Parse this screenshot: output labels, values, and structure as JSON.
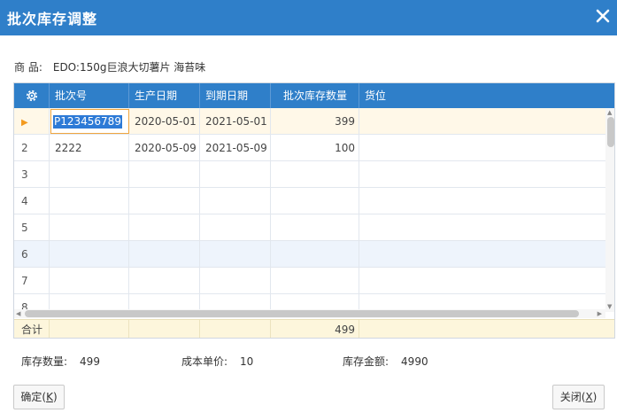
{
  "window": {
    "title": "批次库存调整"
  },
  "product": {
    "label": "商 品:",
    "value": "EDO:150g巨浪大切薯片 海苔味"
  },
  "grid": {
    "columns": [
      "批次号",
      "生产日期",
      "到期日期",
      "批次库存数量",
      "货位"
    ],
    "rows": [
      {
        "num": "",
        "batch": "P123456789",
        "prod": "2020-05-01",
        "exp": "2021-05-01",
        "qty": "399",
        "loc": ""
      },
      {
        "num": "2",
        "batch": "2222",
        "prod": "2020-05-09",
        "exp": "2021-05-09",
        "qty": "100",
        "loc": ""
      },
      {
        "num": "3",
        "batch": "",
        "prod": "",
        "exp": "",
        "qty": "",
        "loc": ""
      },
      {
        "num": "4",
        "batch": "",
        "prod": "",
        "exp": "",
        "qty": "",
        "loc": ""
      },
      {
        "num": "5",
        "batch": "",
        "prod": "",
        "exp": "",
        "qty": "",
        "loc": ""
      },
      {
        "num": "6",
        "batch": "",
        "prod": "",
        "exp": "",
        "qty": "",
        "loc": ""
      },
      {
        "num": "7",
        "batch": "",
        "prod": "",
        "exp": "",
        "qty": "",
        "loc": ""
      },
      {
        "num": "8",
        "batch": "",
        "prod": "",
        "exp": "",
        "qty": "",
        "loc": ""
      }
    ],
    "summary": {
      "label": "合计",
      "qty": "499"
    },
    "current_row_marker": "▶"
  },
  "stats": {
    "qty_label": "库存数量:",
    "qty_value": "499",
    "cost_label": "成本单价:",
    "cost_value": "10",
    "amount_label": "库存金额:",
    "amount_value": "4990"
  },
  "buttons": {
    "confirm_text": "确定(",
    "confirm_key": "K",
    "confirm_end": ")",
    "close_text": "关闭(",
    "close_key": "X",
    "close_end": ")"
  },
  "colors": {
    "accent": "#2f7fc9",
    "selected_row": "#fff8e8",
    "summary_row": "#fdf6dc",
    "marker": "#f39a1e"
  }
}
